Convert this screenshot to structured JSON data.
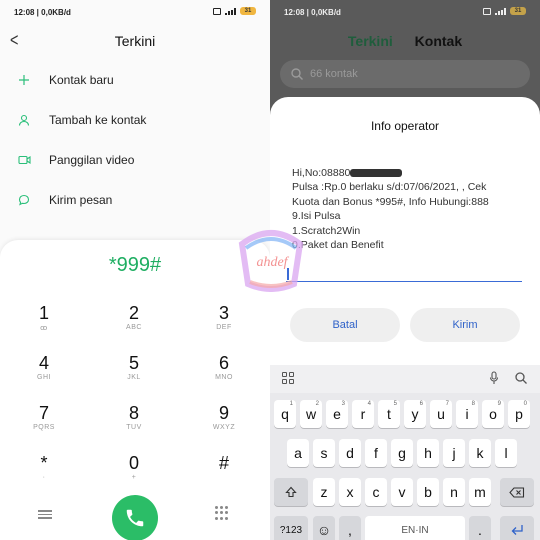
{
  "left": {
    "status_time": "12:08 | 0,0KB/d",
    "battery": "31",
    "title": "Terkini",
    "menu": [
      {
        "label": "Kontak baru",
        "icon": "plus-icon"
      },
      {
        "label": "Tambah ke kontak",
        "icon": "person-icon"
      },
      {
        "label": "Panggilan video",
        "icon": "video-icon"
      },
      {
        "label": "Kirim pesan",
        "icon": "message-icon"
      }
    ],
    "dial_number": "*999#",
    "keys": [
      {
        "d": "1",
        "l": "ꝏ"
      },
      {
        "d": "2",
        "l": "ABC"
      },
      {
        "d": "3",
        "l": "DEF"
      },
      {
        "d": "4",
        "l": "GHI"
      },
      {
        "d": "5",
        "l": "JKL"
      },
      {
        "d": "6",
        "l": "MNO"
      },
      {
        "d": "7",
        "l": "PQRS"
      },
      {
        "d": "8",
        "l": "TUV"
      },
      {
        "d": "9",
        "l": "WXYZ"
      },
      {
        "d": "*",
        "l": "·"
      },
      {
        "d": "0",
        "l": "+"
      },
      {
        "d": "#",
        "l": ""
      }
    ]
  },
  "right": {
    "status_time": "12:08 | 0,0KB/d",
    "battery": "31",
    "tabs": [
      "Terkini",
      "Kontak"
    ],
    "search_placeholder": "66 kontak",
    "dialog": {
      "title": "Info operator",
      "lines": [
        "Hi,No:08880",
        "Pulsa :Rp.0 berlaku s/d:07/06/2021, , Cek",
        "Kuota dan Bonus *995#, Info Hubungi:888",
        "9.Isi Pulsa",
        "1.Scratch2Win",
        "0.Paket dan Benefit"
      ],
      "cancel": "Batal",
      "send": "Kirim"
    },
    "keyboard": {
      "row1": [
        [
          "q",
          "1"
        ],
        [
          "w",
          "2"
        ],
        [
          "e",
          "3"
        ],
        [
          "r",
          "4"
        ],
        [
          "t",
          "5"
        ],
        [
          "y",
          "6"
        ],
        [
          "u",
          "7"
        ],
        [
          "i",
          "8"
        ],
        [
          "o",
          "9"
        ],
        [
          "p",
          "0"
        ]
      ],
      "row2": [
        "a",
        "s",
        "d",
        "f",
        "g",
        "h",
        "j",
        "k",
        "l"
      ],
      "row3": [
        "z",
        "x",
        "c",
        "v",
        "b",
        "n",
        "m"
      ],
      "mode_key": "?123",
      "space_label": "EN·IN",
      "emoji": "☺",
      "comma": ",",
      "period": "."
    }
  },
  "colors": {
    "accent_green": "#2bbd67",
    "dialog_button_text": "#2f62c9",
    "dim_overlay": "#5a5a5a"
  }
}
